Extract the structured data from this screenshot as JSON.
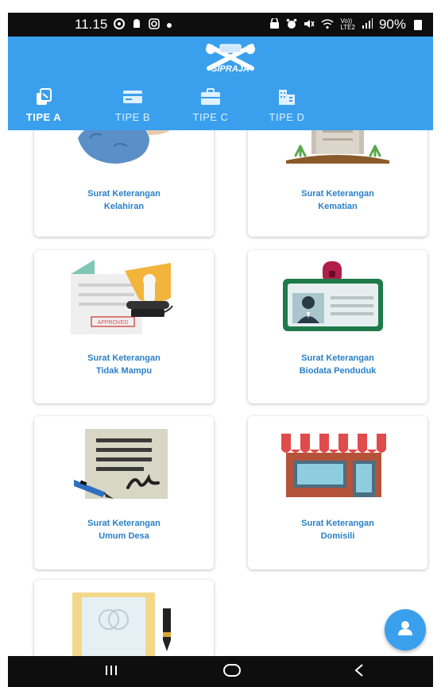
{
  "status_bar": {
    "time": "11.15",
    "battery": "90%",
    "network_label": "Vo))\nLTE2"
  },
  "header": {
    "logo_text": "SIPRAJA"
  },
  "tabs": [
    {
      "label": "TIPE A",
      "icon": "copy-icon",
      "active": true
    },
    {
      "label": "TIPE B",
      "icon": "card-icon",
      "active": false
    },
    {
      "label": "TIPE C",
      "icon": "briefcase-icon",
      "active": false
    },
    {
      "label": "TIPE D",
      "icon": "building-icon",
      "active": false
    }
  ],
  "cards": [
    {
      "line1": "Surat Keterangan",
      "line2": "Kelahiran",
      "icon": "baby-icon"
    },
    {
      "line1": "Surat Keterangan",
      "line2": "Kematian",
      "icon": "grave-icon"
    },
    {
      "line1": "Surat Keterangan",
      "line2": "Tidak Mampu",
      "icon": "approved-stamp-icon",
      "stamp_text": "APPROVED"
    },
    {
      "line1": "Surat Keterangan",
      "line2": "Biodata Penduduk",
      "icon": "id-card-icon"
    },
    {
      "line1": "Surat Keterangan",
      "line2": "Umum Desa",
      "icon": "signed-document-icon"
    },
    {
      "line1": "Surat Keterangan",
      "line2": "Domisili",
      "icon": "shop-icon"
    },
    {
      "line1": "",
      "line2": "",
      "icon": "certificate-pen-icon"
    }
  ],
  "colors": {
    "primary": "#3aa0ee",
    "title_text": "#2a80c8",
    "status_bar_bg": "#0e0e0e"
  },
  "fab": {
    "icon": "person-icon"
  },
  "nav": {
    "buttons": [
      "recent-apps-icon",
      "home-icon",
      "back-icon"
    ]
  }
}
